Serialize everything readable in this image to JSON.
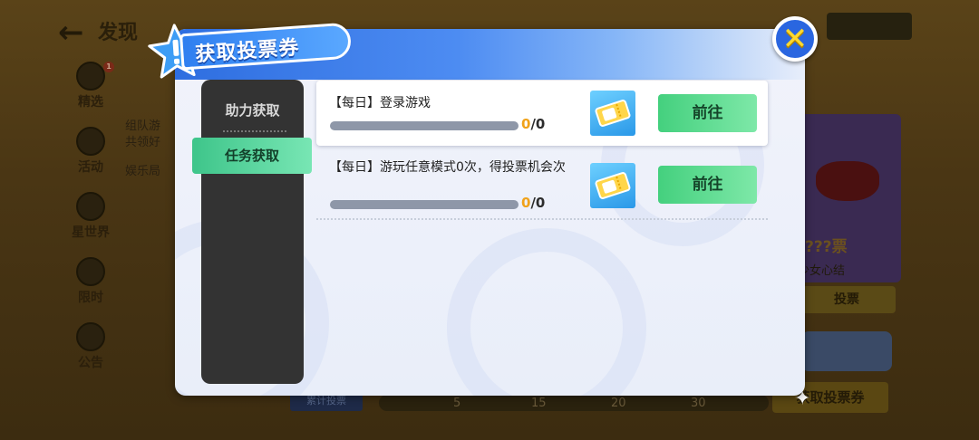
{
  "background": {
    "back_icon": "←",
    "title": "发现",
    "nav": [
      {
        "label": "精选",
        "badge": "1"
      },
      {
        "label": "活动"
      },
      {
        "label": "星世界"
      },
      {
        "label": "限时"
      },
      {
        "label": "公告"
      }
    ],
    "feed": [
      "组队游",
      "共领好",
      "娱乐局"
    ],
    "vote_card": {
      "name": "???票",
      "subtitle": "少女心结",
      "vote_button": "投票"
    },
    "get_ticket_button": "获取投票券",
    "cumulative_label": "累计投票",
    "ticks": [
      "5",
      "15",
      "20",
      "30"
    ]
  },
  "modal": {
    "title": "获取投票券",
    "close_icon": "✕",
    "tabs": [
      {
        "label": "助力获取",
        "active": false
      },
      {
        "label": "任务获取",
        "active": true
      }
    ],
    "tasks": [
      {
        "title": "【每日】登录游戏",
        "progress_current": "0",
        "progress_total": "/0",
        "progress_fraction": 0,
        "icon": "vote-ticket-icon",
        "button": "前往"
      },
      {
        "title": "【每日】游玩任意模式0次，得投票机会次",
        "progress_current": "0",
        "progress_total": "/0",
        "progress_fraction": 0,
        "icon": "vote-ticket-icon",
        "button": "前往"
      }
    ]
  },
  "colors": {
    "accent_blue": "#2f7ff0",
    "go_button_green": "#44d07e",
    "progress_highlight": "#f0a21a",
    "close_yellow": "#ffd92e"
  }
}
